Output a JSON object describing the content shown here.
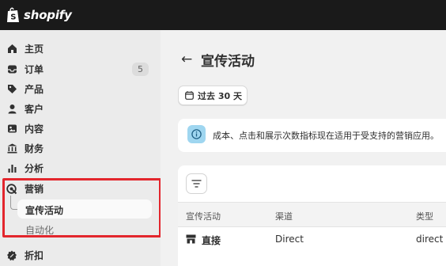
{
  "topbar": {
    "brand": "shopify"
  },
  "sidebar": {
    "items": [
      {
        "label": "主页",
        "icon": "home-icon"
      },
      {
        "label": "订单",
        "icon": "inbox-icon",
        "badge": "5"
      },
      {
        "label": "产品",
        "icon": "tag-icon"
      },
      {
        "label": "客户",
        "icon": "person-icon"
      },
      {
        "label": "内容",
        "icon": "content-icon"
      },
      {
        "label": "财务",
        "icon": "bank-icon"
      },
      {
        "label": "分析",
        "icon": "bar-chart-icon"
      },
      {
        "label": "营销",
        "icon": "target-icon"
      },
      {
        "label": "折扣",
        "icon": "discount-icon"
      }
    ],
    "marketing_sub": {
      "active": "宣传活动",
      "other": "自动化"
    }
  },
  "main": {
    "title": "宣传活动",
    "date_filter": "过去 30 天",
    "banner": {
      "text": "成本、点击和展示次数指标现在适用于受支持的营销应用。"
    },
    "table": {
      "headers": [
        "宣传活动",
        "渠道",
        "类型"
      ],
      "rows": [
        {
          "name": "直接",
          "channel": "Direct",
          "type": "direct"
        }
      ]
    }
  },
  "colors": {
    "highlight": "#e3262d",
    "topbar": "#1a1a1a",
    "info_icon_bg": "#9fd6f0"
  }
}
